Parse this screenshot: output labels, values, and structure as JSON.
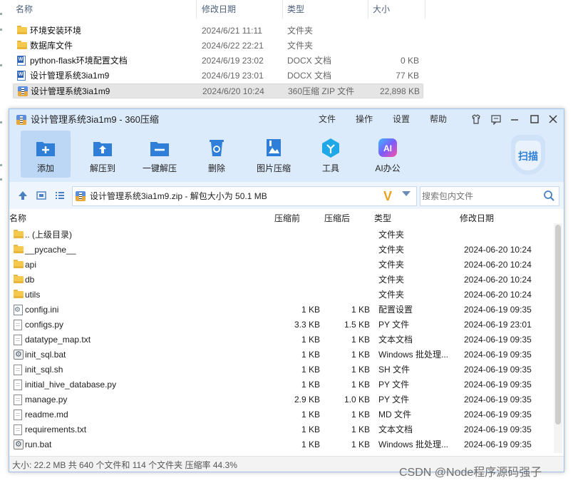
{
  "explorer": {
    "columns": [
      "名称",
      "修改日期",
      "类型",
      "大小"
    ],
    "rows": [
      {
        "name": "环境安装环境",
        "date": "2024/6/21 11:11",
        "type": "文件夹",
        "size": "",
        "icon": "folder-icon"
      },
      {
        "name": "数据库文件",
        "date": "2024/6/22 22:21",
        "type": "文件夹",
        "size": "",
        "icon": "folder-icon"
      },
      {
        "name": "python-flask环境配置文档",
        "date": "2024/6/19 23:02",
        "type": "DOCX 文档",
        "size": "0 KB",
        "icon": "docx-icon"
      },
      {
        "name": "设计管理系统3ia1m9",
        "date": "2024/6/19 23:01",
        "type": "DOCX 文档",
        "size": "77 KB",
        "icon": "docx-icon"
      },
      {
        "name": "设计管理系统3ia1m9",
        "date": "2024/6/20 10:24",
        "type": "360压缩 ZIP 文件",
        "size": "22,898 KB",
        "icon": "zip-icon",
        "selected": true
      }
    ]
  },
  "window": {
    "title": "设计管理系统3ia1m9 - 360压缩",
    "menu": [
      "文件",
      "操作",
      "设置",
      "帮助"
    ],
    "toolbar": [
      "添加",
      "解压到",
      "一键解压",
      "删除",
      "图片压缩",
      "工具",
      "AI办公"
    ],
    "scan_label": "扫描",
    "address": "设计管理系统3ia1m9.zip - 解包大小为 50.1 MB",
    "search_placeholder": "搜索包内文件",
    "columns": [
      "名称",
      "压缩前",
      "压缩后",
      "类型",
      "修改日期"
    ],
    "rows": [
      {
        "name": ".. (上级目录)",
        "comp": "",
        "orig": "",
        "type": "文件夹",
        "date": "",
        "icon": "folder-icon"
      },
      {
        "name": "__pycache__",
        "comp": "",
        "orig": "",
        "type": "文件夹",
        "date": "2024-06-20 10:24",
        "icon": "folder-icon"
      },
      {
        "name": "api",
        "comp": "",
        "orig": "",
        "type": "文件夹",
        "date": "2024-06-20 10:24",
        "icon": "folder-icon"
      },
      {
        "name": "db",
        "comp": "",
        "orig": "",
        "type": "文件夹",
        "date": "2024-06-20 10:24",
        "icon": "folder-icon"
      },
      {
        "name": "utils",
        "comp": "",
        "orig": "",
        "type": "文件夹",
        "date": "2024-06-20 10:24",
        "icon": "folder-icon"
      },
      {
        "name": "config.ini",
        "comp": "1 KB",
        "orig": "1 KB",
        "type": "配置设置",
        "date": "2024-06-19 09:35",
        "icon": "config-file-icon"
      },
      {
        "name": "configs.py",
        "comp": "3.3 KB",
        "orig": "1.5 KB",
        "type": "PY 文件",
        "date": "2024-06-19 23:01",
        "icon": "file-icon"
      },
      {
        "name": "datatype_map.txt",
        "comp": "1 KB",
        "orig": "1 KB",
        "type": "文本文档",
        "date": "2024-06-19 09:35",
        "icon": "file-icon"
      },
      {
        "name": "init_sql.bat",
        "comp": "1 KB",
        "orig": "1 KB",
        "type": "Windows 批处理...",
        "date": "2024-06-19 09:35",
        "icon": "bat-file-icon"
      },
      {
        "name": "init_sql.sh",
        "comp": "1 KB",
        "orig": "1 KB",
        "type": "SH 文件",
        "date": "2024-06-19 09:35",
        "icon": "file-icon"
      },
      {
        "name": "initial_hive_database.py",
        "comp": "1 KB",
        "orig": "1 KB",
        "type": "PY 文件",
        "date": "2024-06-19 09:35",
        "icon": "file-icon"
      },
      {
        "name": "manage.py",
        "comp": "2.9 KB",
        "orig": "1.0 KB",
        "type": "PY 文件",
        "date": "2024-06-19 09:35",
        "icon": "file-icon"
      },
      {
        "name": "readme.md",
        "comp": "1 KB",
        "orig": "1 KB",
        "type": "MD 文件",
        "date": "2024-06-19 09:35",
        "icon": "file-icon"
      },
      {
        "name": "requirements.txt",
        "comp": "1 KB",
        "orig": "1 KB",
        "type": "文本文档",
        "date": "2024-06-19 09:35",
        "icon": "file-icon"
      },
      {
        "name": "run.bat",
        "comp": "1 KB",
        "orig": "1 KB",
        "type": "Windows 批处理...",
        "date": "2024-06-19 09:35",
        "icon": "bat-file-icon"
      }
    ],
    "status": "大小: 22.2 MB 共 640 个文件和 114 个文件夹 压缩率 44.3%"
  },
  "watermark": "CSDN @Node程序源码强子",
  "colors": {
    "accent": "#2f7fd8",
    "titlebar": "#dcebfb",
    "toolbar_active": "#bcd7f6"
  }
}
